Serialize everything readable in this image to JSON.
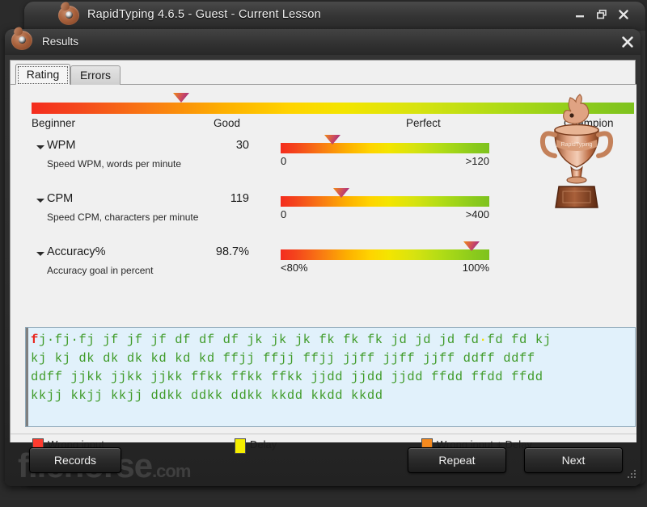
{
  "window": {
    "title": "RapidTyping 4.6.5 - Guest - Current Lesson",
    "minimize_label": "minimize",
    "restore_label": "restore",
    "close_label": "close"
  },
  "dialog": {
    "title": "Results",
    "close_label": "close"
  },
  "tabs": [
    {
      "label": "Rating",
      "active": true
    },
    {
      "label": "Errors",
      "active": false
    }
  ],
  "rating": {
    "marker_percent": 24.8,
    "scale_labels": [
      "Beginner",
      "Good",
      "Perfect",
      "Champion"
    ],
    "gradient_from": "#f42c1e",
    "gradient_to": "#7ec21e",
    "marker_color": "#8f1c96"
  },
  "metrics": [
    {
      "name": "WPM",
      "value": "30",
      "description": "Speed WPM, words per minute",
      "min_label": "0",
      "max_label": ">120",
      "marker_percent": 25.0
    },
    {
      "name": "CPM",
      "value": "119",
      "description": "Speed CPM, characters per minute",
      "min_label": "0",
      "max_label": ">400",
      "marker_percent": 29.0
    },
    {
      "name": "Accuracy%",
      "value": "98.7%",
      "description": "Accuracy goal in percent",
      "min_label": "<80%",
      "max_label": "100%",
      "marker_percent": 91.5
    }
  ],
  "trophy": {
    "alt": "bronze trophy with rabbit mascot",
    "banner_text": "RapidTyping"
  },
  "typed_text": {
    "lines": [
      [
        {
          "t": "f",
          "k": "err"
        },
        {
          "t": "j",
          "k": "ok"
        },
        {
          "t": "·",
          "k": "ok"
        },
        {
          "t": "fj",
          "k": "ok"
        },
        {
          "t": "·",
          "k": "ok"
        },
        {
          "t": "fj jf jf jf df df df jk jk jk fk fk fk jd jd jd fd",
          "k": "ok"
        },
        {
          "t": "·",
          "k": "dly"
        },
        {
          "t": "fd fd kj",
          "k": "ok"
        }
      ],
      [
        {
          "t": "kj kj dk dk dk kd kd kd ffjj ffjj ffjj jjff jjff jjff ddff ddff",
          "k": "ok"
        }
      ],
      [
        {
          "t": "ddff jjkk jjkk jjkk ffkk ffkk ffkk jjdd jjdd jjdd ffdd ffdd ffdd",
          "k": "ok"
        }
      ],
      [
        {
          "t": "kkjj kkjj kkjj ddkk ddkk ddkk kkdd kkdd kkdd",
          "k": "ok"
        }
      ]
    ]
  },
  "legend": [
    {
      "label": "Wrong input",
      "color": "#ff3b2f"
    },
    {
      "label": "Delay",
      "color": "#f5ee00"
    },
    {
      "label": "Wrong input + Delay",
      "color": "#f68a1e"
    }
  ],
  "buttons": {
    "records": "Records",
    "repeat": "Repeat",
    "next": "Next"
  },
  "watermark": {
    "name": "filehorse",
    "suffix": ".com"
  }
}
